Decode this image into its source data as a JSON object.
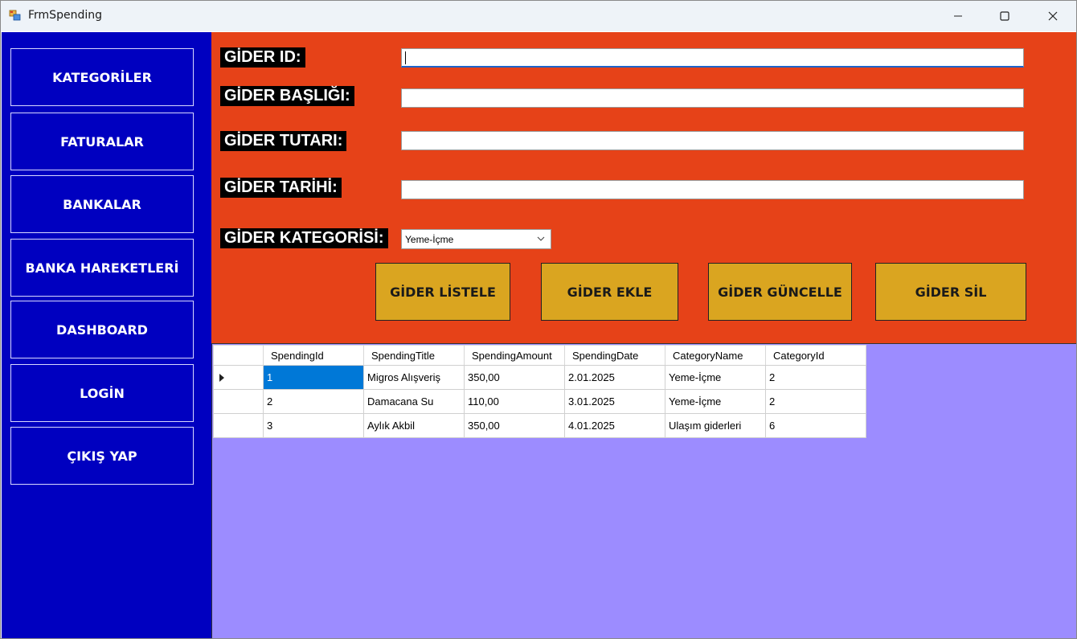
{
  "window": {
    "title": "FrmSpending"
  },
  "sidebar": {
    "items": [
      {
        "label": "KATEGORİLER"
      },
      {
        "label": "FATURALAR"
      },
      {
        "label": "BANKALAR"
      },
      {
        "label": "BANKA HAREKETLERİ"
      },
      {
        "label": "DASHBOARD"
      },
      {
        "label": "LOGİN"
      },
      {
        "label": "ÇIKIŞ YAP"
      }
    ]
  },
  "form": {
    "id_label": "GİDER ID:",
    "id_value": "",
    "title_label": "GİDER BAŞLIĞI:",
    "title_value": "",
    "amount_label": "GİDER TUTARI:",
    "amount_value": "",
    "date_label": "GİDER TARİHİ:",
    "date_value": "",
    "category_label": "GİDER KATEGORİSİ:",
    "category_selected": "Yeme-İçme"
  },
  "actions": {
    "list": "GİDER LİSTELE",
    "add": "GİDER EKLE",
    "update": "GİDER GÜNCELLE",
    "delete": "GİDER SİL"
  },
  "grid": {
    "columns": [
      "SpendingId",
      "SpendingTitle",
      "SpendingAmount",
      "SpendingDate",
      "CategoryName",
      "CategoryId"
    ],
    "rows": [
      [
        "1",
        "Migros Alışveriş",
        "350,00",
        "2.01.2025",
        "Yeme-İçme",
        "2"
      ],
      [
        "2",
        "Damacana Su",
        "110,00",
        "3.01.2025",
        "Yeme-İçme",
        "2"
      ],
      [
        "3",
        "Aylık Akbil",
        "350,00",
        "4.01.2025",
        "Ulaşım giderleri",
        "6"
      ]
    ]
  },
  "colors": {
    "sidebar": "#0000c0",
    "form_panel": "#e64218",
    "action_button": "#daa520",
    "grid_background": "#9c8cff",
    "selection": "#0078d7"
  }
}
